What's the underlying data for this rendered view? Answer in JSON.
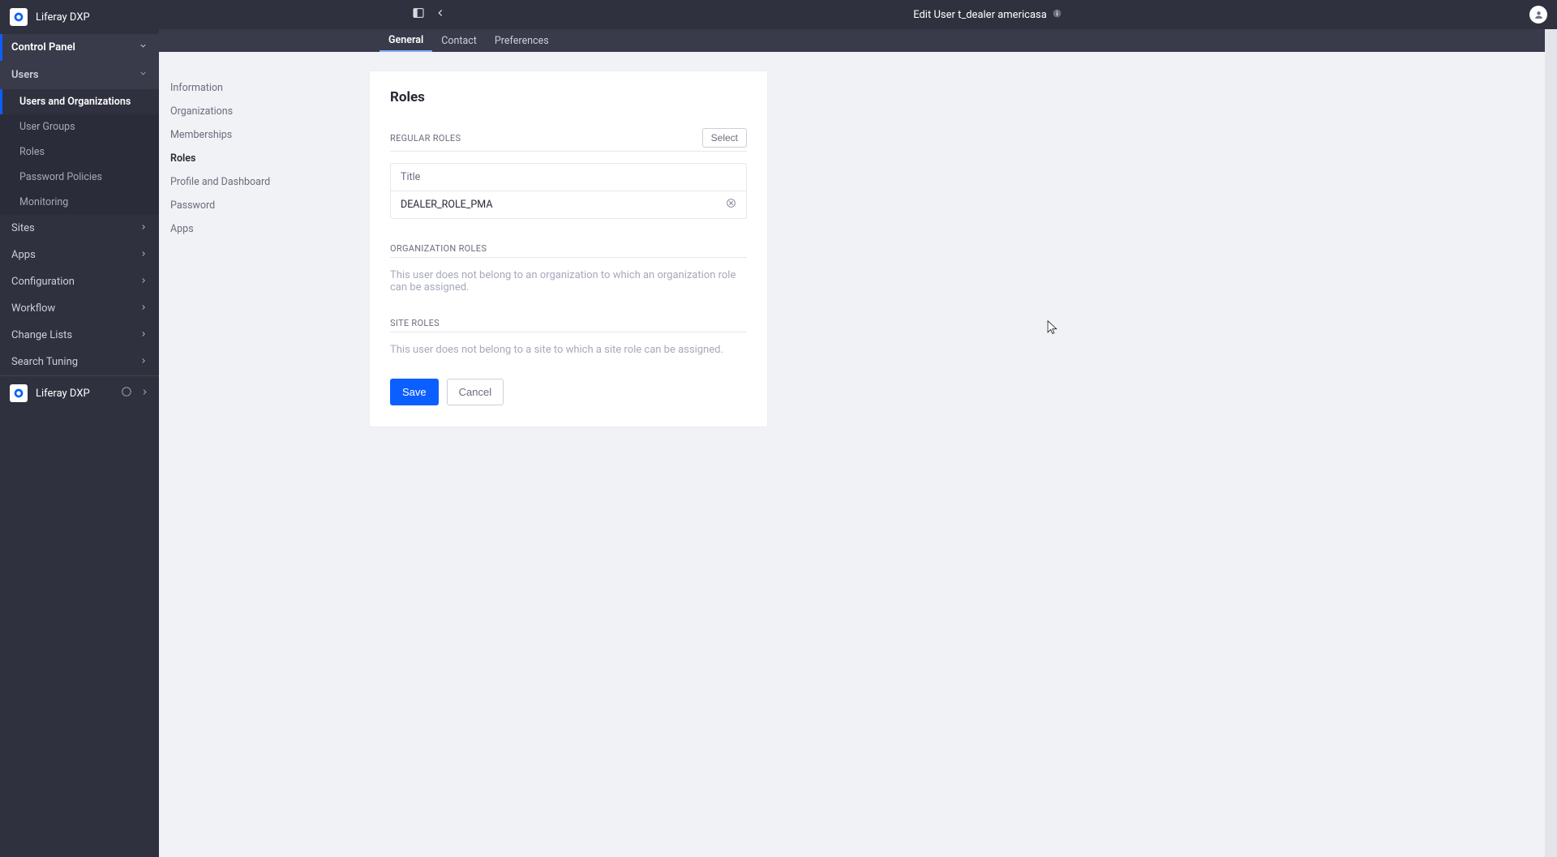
{
  "app_name": "Liferay DXP",
  "header": {
    "title": "Edit User t_dealer americasa"
  },
  "tabs": [
    {
      "label": "General",
      "active": true
    },
    {
      "label": "Contact",
      "active": false
    },
    {
      "label": "Preferences",
      "active": false
    }
  ],
  "sidebar": {
    "control_panel": "Control Panel",
    "users": "Users",
    "subitems": [
      {
        "label": "Users and Organizations",
        "active": true
      },
      {
        "label": "User Groups"
      },
      {
        "label": "Roles"
      },
      {
        "label": "Password Policies"
      },
      {
        "label": "Monitoring"
      }
    ],
    "items": [
      {
        "label": "Sites"
      },
      {
        "label": "Apps"
      },
      {
        "label": "Configuration"
      },
      {
        "label": "Workflow"
      },
      {
        "label": "Change Lists"
      },
      {
        "label": "Search Tuning"
      }
    ],
    "footer_label": "Liferay DXP"
  },
  "sidenav": [
    {
      "label": "Information"
    },
    {
      "label": "Organizations"
    },
    {
      "label": "Memberships"
    },
    {
      "label": "Roles",
      "active": true
    },
    {
      "label": "Profile and Dashboard"
    },
    {
      "label": "Password"
    },
    {
      "label": "Apps"
    }
  ],
  "panel": {
    "title": "Roles",
    "regular": {
      "title": "REGULAR ROLES",
      "select_label": "Select",
      "column_title": "Title",
      "row_value": "DEALER_ROLE_PMA"
    },
    "organization": {
      "title": "ORGANIZATION ROLES",
      "empty": "This user does not belong to an organization to which an organization role can be assigned."
    },
    "site": {
      "title": "SITE ROLES",
      "empty": "This user does not belong to a site to which a site role can be assigned."
    },
    "save_label": "Save",
    "cancel_label": "Cancel"
  }
}
